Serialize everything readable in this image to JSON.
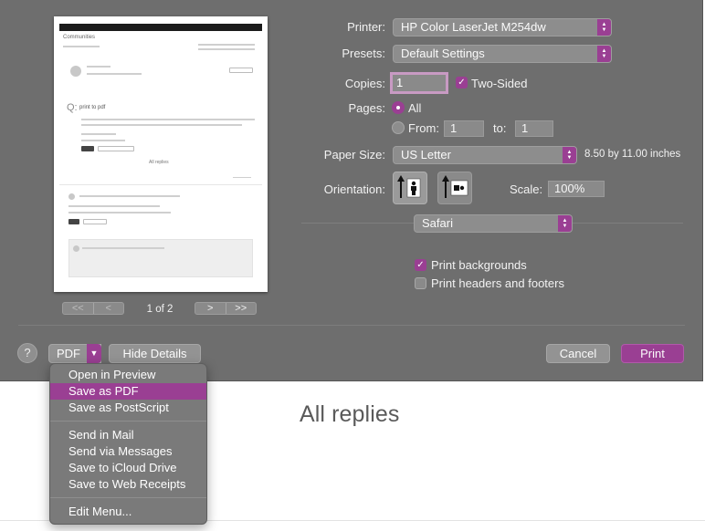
{
  "background_page": {
    "heading": "All replies"
  },
  "preview": {
    "page_text": {
      "q_mark": "Q:",
      "question_title": "print to pdf",
      "all_replies": "All replies",
      "site": "Communities"
    },
    "page_indicator": "1 of 2",
    "nav_first": "<<",
    "nav_prev": "<",
    "nav_next": ">",
    "nav_last": ">>"
  },
  "form": {
    "printer_label": "Printer:",
    "printer_value": "HP Color LaserJet M254dw",
    "presets_label": "Presets:",
    "presets_value": "Default Settings",
    "copies_label": "Copies:",
    "copies_value": "1",
    "two_sided_label": "Two-Sided",
    "two_sided_checked": true,
    "pages_label": "Pages:",
    "pages_all_label": "All",
    "pages_from_label": "From:",
    "pages_from_value": "1",
    "pages_to_label": "to:",
    "pages_to_value": "1",
    "paper_size_label": "Paper Size:",
    "paper_size_value": "US Letter",
    "paper_size_dims": "8.50 by 11.00 inches",
    "orientation_label": "Orientation:",
    "scale_label": "Scale:",
    "scale_value": "100%",
    "app_section_value": "Safari",
    "print_backgrounds_label": "Print backgrounds",
    "print_backgrounds_checked": true,
    "print_headers_label": "Print headers and footers",
    "print_headers_checked": false
  },
  "buttons": {
    "help": "?",
    "pdf": "PDF",
    "hide_details": "Hide Details",
    "cancel": "Cancel",
    "print": "Print"
  },
  "pdf_menu": {
    "items": [
      "Open in Preview",
      "Save as PDF",
      "Save as PostScript",
      "Send in Mail",
      "Send via Messages",
      "Save to iCloud Drive",
      "Save to Web Receipts",
      "Edit Menu..."
    ],
    "highlighted": "Save as PDF"
  },
  "colors": {
    "accent": "#9a3f93",
    "dialog_bg": "#6e6e6e"
  },
  "icons": {
    "popup": "up-down-chevron-icon",
    "checkbox": "checkmark-icon",
    "portrait": "portrait-orientation-icon",
    "landscape": "landscape-orientation-icon",
    "pdf_menu": "chevron-down-icon"
  }
}
